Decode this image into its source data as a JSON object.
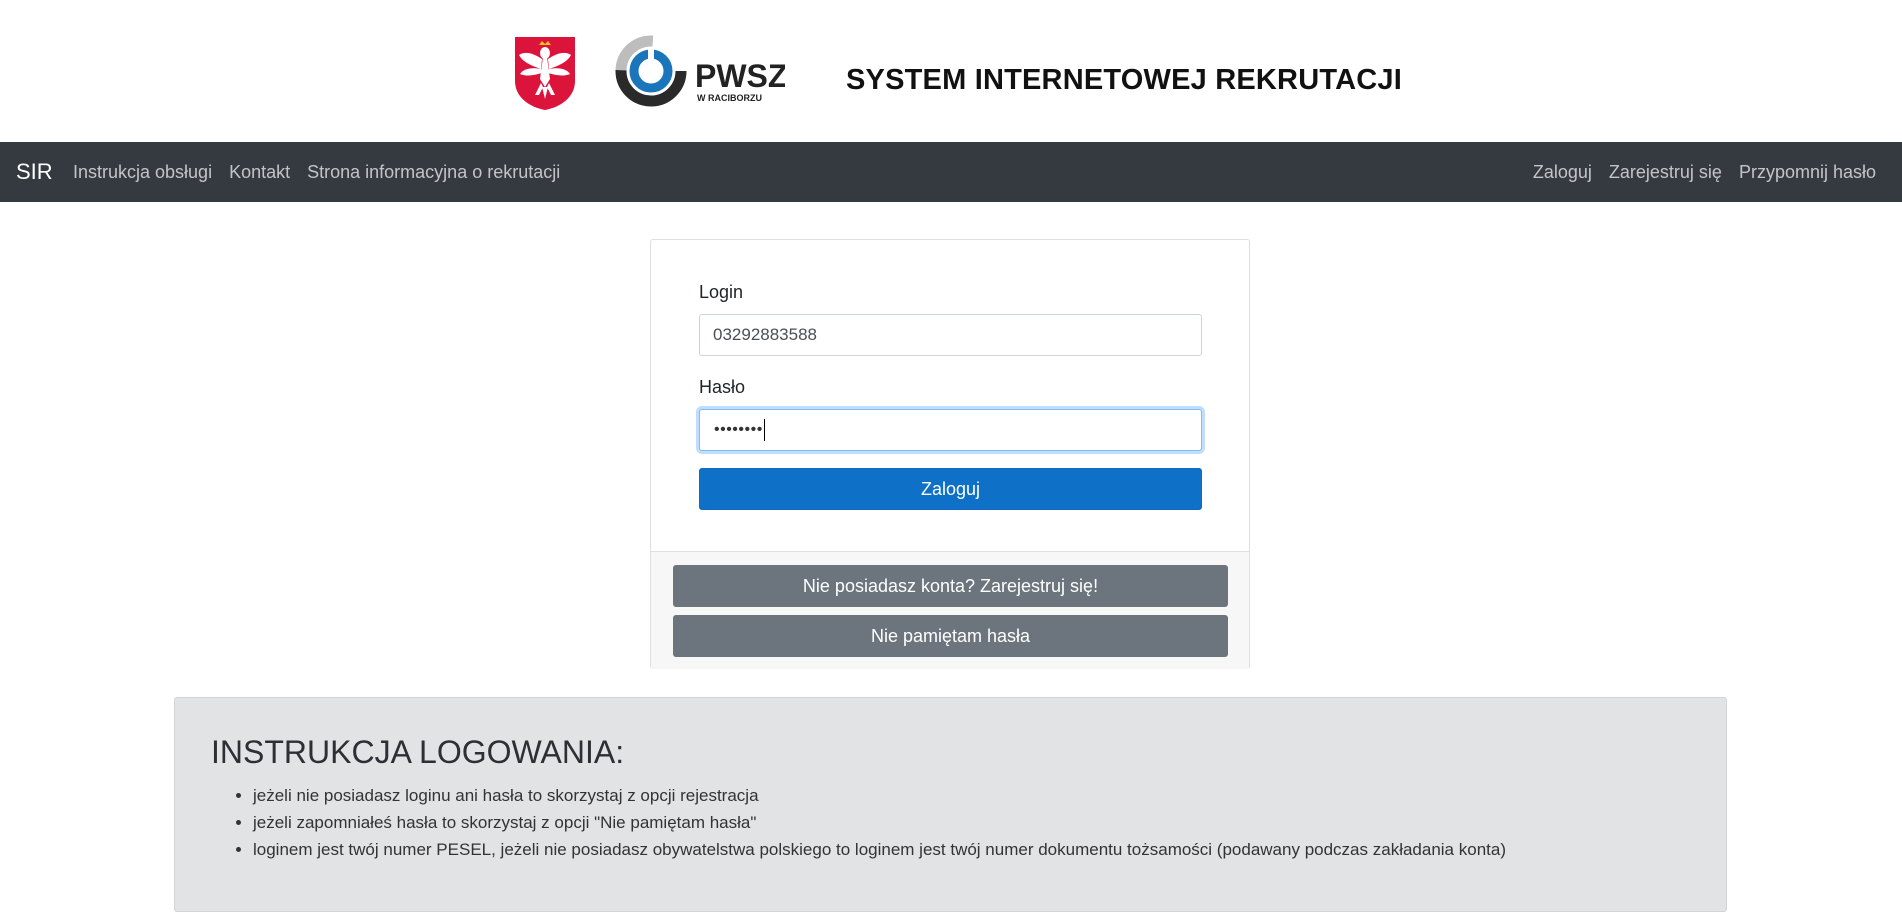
{
  "header": {
    "logo_text": "PWSZ",
    "logo_subtext": "W RACIBORZU",
    "title": "SYSTEM INTERNETOWEJ REKRUTACJI"
  },
  "navbar": {
    "brand": "SIR",
    "left_links": [
      "Instrukcja obsługi",
      "Kontakt",
      "Strona informacyjna o rekrutacji"
    ],
    "right_links": [
      "Zaloguj",
      "Zarejestruj się",
      "Przypomnij hasło"
    ]
  },
  "login": {
    "login_label": "Login",
    "login_value": "03292883588",
    "password_label": "Hasło",
    "password_masked": "••••••••",
    "submit_label": "Zaloguj",
    "register_label": "Nie posiadasz konta? Zarejestruj się!",
    "forgot_label": "Nie pamiętam hasła"
  },
  "instructions": {
    "title": "INSTRUKCJA LOGOWANIA:",
    "items": [
      "jeżeli nie posiadasz loginu ani hasła to skorzystaj z opcji rejestracja",
      "jeżeli zapomniałeś hasła to skorzystaj z opcji \"Nie pamiętam hasła\"",
      "loginem jest twój numer PESEL, jeżeli nie posiadasz obywatelstwa polskiego to loginem jest twój numer dokumentu tożsamości (podawany podczas zakładania konta)"
    ]
  },
  "colors": {
    "navbar_bg": "#343a40",
    "primary": "#0f70c8",
    "secondary": "#6c757d",
    "eagle_red": "#dc143c",
    "logo_blue": "#1b75bb"
  }
}
